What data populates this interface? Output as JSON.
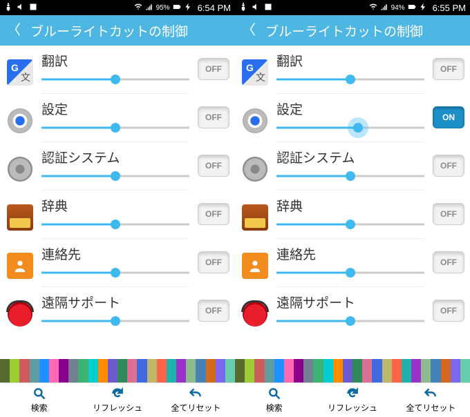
{
  "screens": [
    {
      "status": {
        "batteryText": "95%",
        "time": "6:54 PM"
      },
      "header": {
        "title": "ブルーライトカットの制御"
      },
      "apps": [
        {
          "name": "翻訳",
          "iconType": "translate",
          "sliderPct": 50,
          "toggle": "OFF",
          "glow": false
        },
        {
          "name": "設定",
          "iconType": "gear",
          "sliderPct": 50,
          "toggle": "OFF",
          "glow": false
        },
        {
          "name": "認証システム",
          "iconType": "auth",
          "sliderPct": 50,
          "toggle": "OFF",
          "glow": false
        },
        {
          "name": "辞典",
          "iconType": "dict",
          "sliderPct": 50,
          "toggle": "OFF",
          "glow": false
        },
        {
          "name": "連絡先",
          "iconType": "contact",
          "sliderPct": 50,
          "toggle": "OFF",
          "glow": false
        },
        {
          "name": "遠隔サポート",
          "iconType": "remote",
          "sliderPct": 50,
          "toggle": "OFF",
          "glow": false
        }
      ]
    },
    {
      "status": {
        "batteryText": "94%",
        "time": "6:55 PM"
      },
      "header": {
        "title": "ブルーライトカットの制御"
      },
      "apps": [
        {
          "name": "翻訳",
          "iconType": "translate",
          "sliderPct": 50,
          "toggle": "OFF",
          "glow": false
        },
        {
          "name": "設定",
          "iconType": "gear",
          "sliderPct": 55,
          "toggle": "ON",
          "glow": true
        },
        {
          "name": "認証システム",
          "iconType": "auth",
          "sliderPct": 50,
          "toggle": "OFF",
          "glow": false
        },
        {
          "name": "辞典",
          "iconType": "dict",
          "sliderPct": 50,
          "toggle": "OFF",
          "glow": false
        },
        {
          "name": "連絡先",
          "iconType": "contact",
          "sliderPct": 50,
          "toggle": "OFF",
          "glow": false
        },
        {
          "name": "遠隔サポート",
          "iconType": "remote",
          "sliderPct": 50,
          "toggle": "OFF",
          "glow": false
        }
      ]
    }
  ],
  "bottomBar": {
    "search": "検索",
    "refresh": "リフレッシュ",
    "resetAll": "全てリセット"
  },
  "toggleLabels": {
    "on": "ON",
    "off": "OFF"
  },
  "pixelColors": [
    "#556b2f",
    "#9acd32",
    "#cd5c5c",
    "#5f9ea0",
    "#1e90ff",
    "#ff69b4",
    "#8b008b",
    "#708090",
    "#3cb371",
    "#00ced1",
    "#ff8c00",
    "#6a5acd",
    "#2e8b57",
    "#db7093",
    "#4169e1",
    "#bdb76b",
    "#ff6347",
    "#20b2aa",
    "#9932cc",
    "#8fbc8f",
    "#4682b4",
    "#d2691e",
    "#7b68ee",
    "#66cdaa"
  ]
}
